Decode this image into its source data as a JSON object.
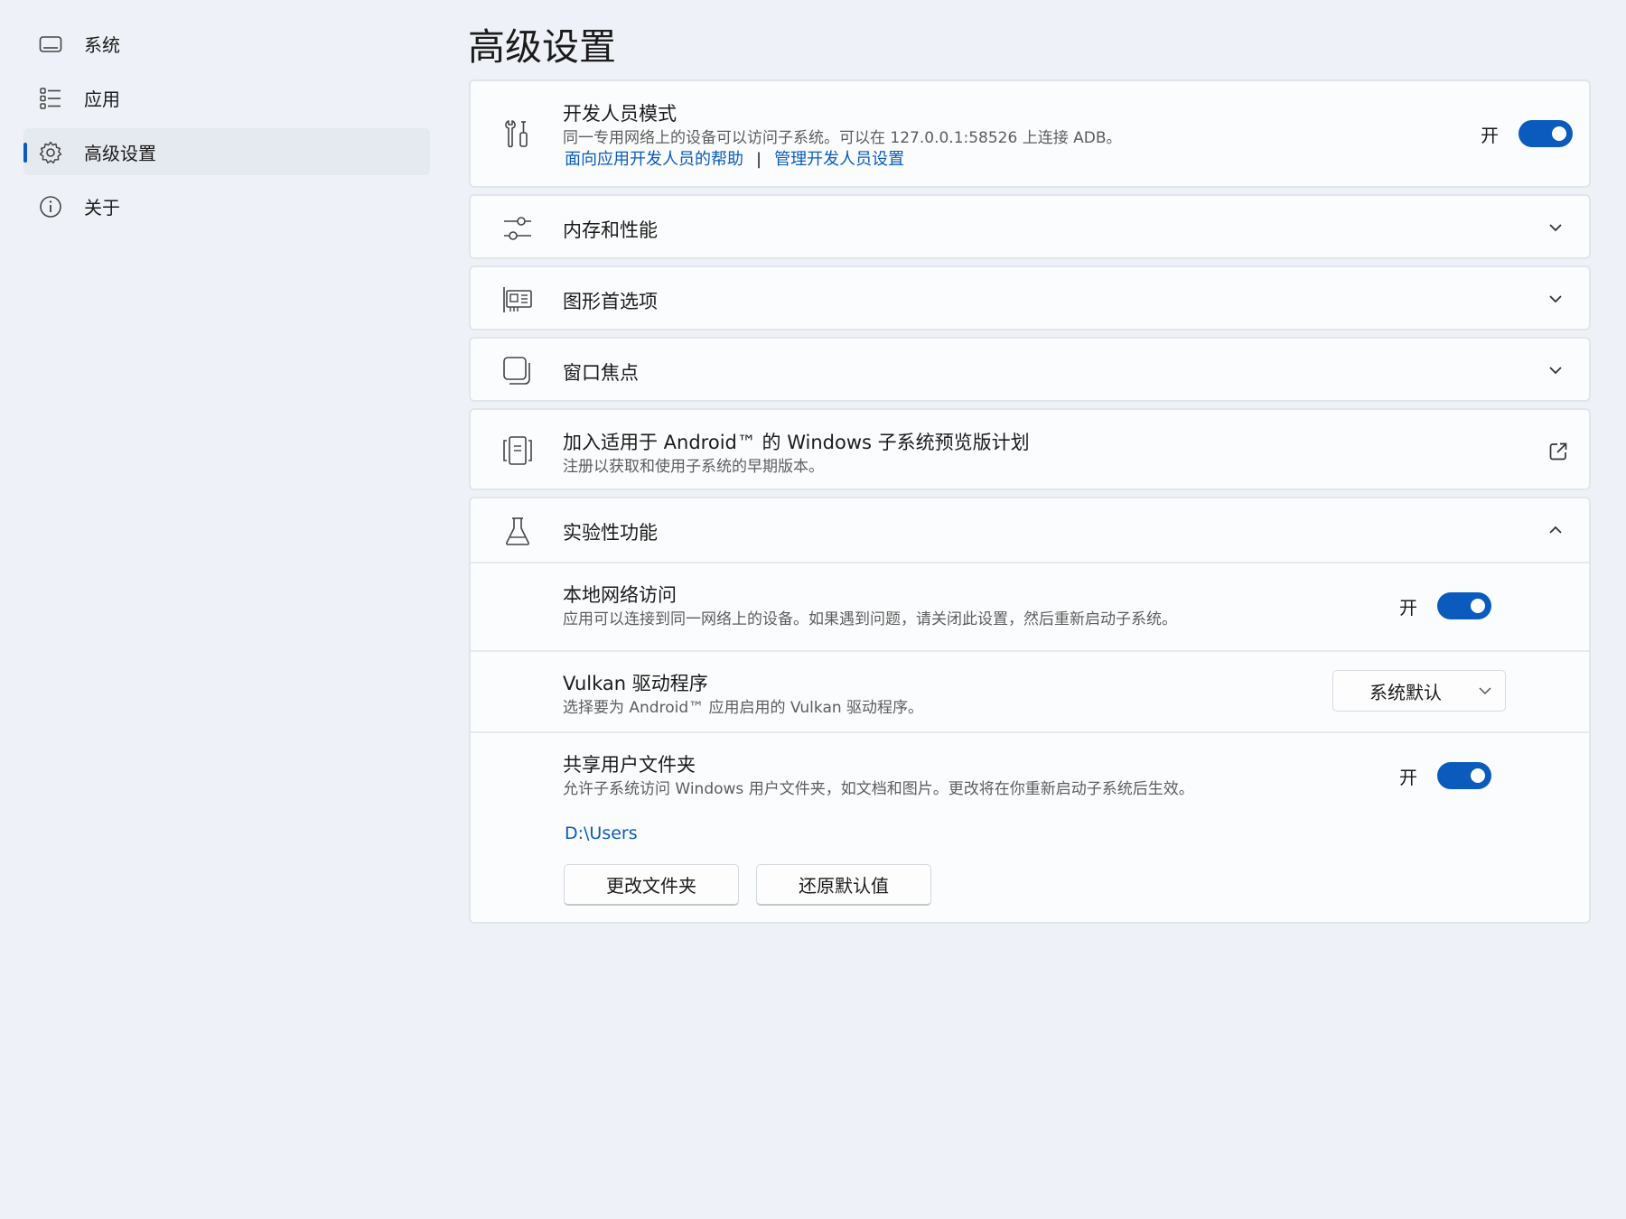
{
  "sidebar": {
    "items": [
      {
        "label": "系统",
        "icon": "laptop-icon"
      },
      {
        "label": "应用",
        "icon": "list-icon"
      },
      {
        "label": "高级设置",
        "icon": "gear-icon",
        "active": true
      },
      {
        "label": "关于",
        "icon": "info-icon"
      }
    ]
  },
  "page": {
    "title": "高级设置"
  },
  "developer_mode": {
    "title": "开发人员模式",
    "description": "同一专用网络上的设备可以访问子系统。可以在 127.0.0.1:58526 上连接 ADB。",
    "link_help": "面向应用开发人员的帮助",
    "separator": "|",
    "link_manage": "管理开发人员设置",
    "toggle_label": "开",
    "toggle_on": true
  },
  "memory": {
    "title": "内存和性能"
  },
  "graphics": {
    "title": "图形首选项"
  },
  "window_focus": {
    "title": "窗口焦点"
  },
  "preview_program": {
    "title": "加入适用于 Android™ 的 Windows 子系统预览版计划",
    "description": "注册以获取和使用子系统的早期版本。"
  },
  "experimental": {
    "title": "实验性功能",
    "local_network": {
      "title": "本地网络访问",
      "description": "应用可以连接到同一网络上的设备。如果遇到问题，请关闭此设置，然后重新启动子系统。",
      "toggle_label": "开",
      "toggle_on": true
    },
    "vulkan": {
      "title": "Vulkan 驱动程序",
      "description": "选择要为 Android™ 应用启用的 Vulkan 驱动程序。",
      "selected": "系统默认"
    },
    "shared_folder": {
      "title": "共享用户文件夹",
      "description": "允许子系统访问 Windows 用户文件夹，如文档和图片。更改将在你重新启动子系统后生效。",
      "toggle_label": "开",
      "toggle_on": true,
      "path": "D:\\Users",
      "change_button": "更改文件夹",
      "restore_button": "还原默认值"
    }
  },
  "colors": {
    "accent": "#0a5bbd",
    "background": "#eef2f8",
    "card": "#fbfcfd"
  }
}
